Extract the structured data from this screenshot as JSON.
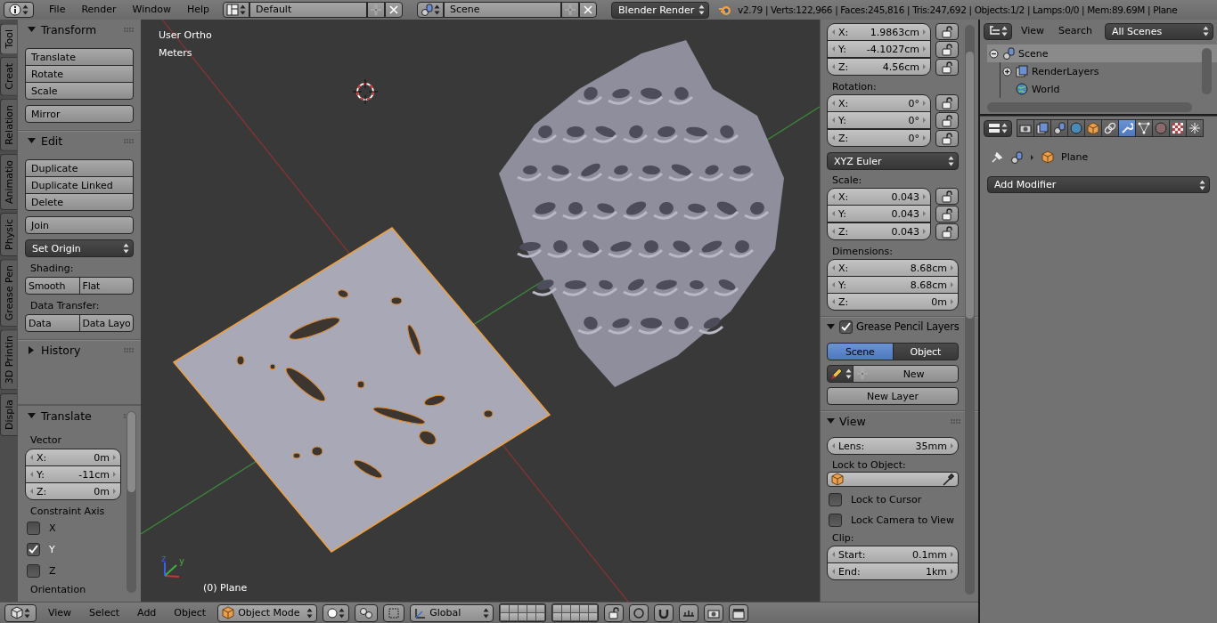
{
  "topbar": {
    "menus": [
      "File",
      "Render",
      "Window",
      "Help"
    ],
    "layout": "Default",
    "scene": "Scene",
    "engine": "Blender Render",
    "stats": "v2.79 | Verts:122,966 | Faces:245,816 | Tris:247,692 | Objects:1/2 | Lamps:0/0 | Mem:89.69M | Plane"
  },
  "tool_tabs": [
    {
      "label": "Tool",
      "selected": true
    },
    {
      "label": "Creat",
      "selected": false
    },
    {
      "label": "Relation",
      "selected": false
    },
    {
      "label": "Animatio",
      "selected": false
    },
    {
      "label": "Physic",
      "selected": false
    },
    {
      "label": "Grease Pen",
      "selected": false
    },
    {
      "label": "3D Printin",
      "selected": false
    },
    {
      "label": "Displa",
      "selected": false
    }
  ],
  "tool_shelf": {
    "panels": [
      {
        "title": "Transform",
        "expanded": true,
        "items": [
          {
            "kind": "button_column",
            "labels": [
              "Translate",
              "Rotate",
              "Scale"
            ]
          },
          {
            "kind": "button_column",
            "labels": [
              "Mirror"
            ]
          }
        ]
      },
      {
        "title": "Edit",
        "expanded": true,
        "items": [
          {
            "kind": "button_column",
            "labels": [
              "Duplicate",
              "Duplicate Linked",
              "Delete"
            ]
          },
          {
            "kind": "button_column",
            "labels": [
              "Join"
            ]
          },
          {
            "kind": "dropdown",
            "value": "Set Origin"
          },
          {
            "kind": "label",
            "text": "Shading:"
          },
          {
            "kind": "button_row",
            "labels": [
              "Smooth",
              "Flat"
            ]
          },
          {
            "kind": "label",
            "text": "Data Transfer:"
          },
          {
            "kind": "button_row",
            "labels": [
              "Data",
              "Data Layo"
            ]
          }
        ]
      },
      {
        "title": "History",
        "expanded": false
      }
    ]
  },
  "operator_panel": {
    "title": "Translate",
    "expanded": true,
    "items": [
      {
        "kind": "label",
        "text": "Vector"
      },
      {
        "kind": "vector",
        "fields": [
          {
            "label": "X:",
            "value": "0m"
          },
          {
            "label": "Y:",
            "value": "-11cm"
          },
          {
            "label": "Z:",
            "value": "0m"
          }
        ]
      },
      {
        "kind": "label",
        "text": "Constraint Axis"
      },
      {
        "kind": "checkbox",
        "label": "X",
        "checked": false
      },
      {
        "kind": "checkbox",
        "label": "Y",
        "checked": true
      },
      {
        "kind": "checkbox",
        "label": "Z",
        "checked": false
      },
      {
        "kind": "label",
        "text": "Orientation"
      }
    ]
  },
  "viewport": {
    "view_name": "User Ortho",
    "units": "Meters",
    "object_info": "(0) Plane",
    "axis_labels": [
      "z",
      "y"
    ]
  },
  "n_panel": {
    "items": [
      {
        "kind": "vector",
        "fields": [
          {
            "label": "X:",
            "value": "1.9863cm",
            "locked": false
          },
          {
            "label": "Y:",
            "value": "-4.1027cm",
            "locked": false
          },
          {
            "label": "Z:",
            "value": "4.56cm",
            "locked": false
          }
        ]
      },
      {
        "kind": "label",
        "text": "Rotation:"
      },
      {
        "kind": "vector",
        "fields": [
          {
            "label": "X:",
            "value": "0°",
            "locked": false
          },
          {
            "label": "Y:",
            "value": "0°",
            "locked": false
          },
          {
            "label": "Z:",
            "value": "0°",
            "locked": false
          }
        ]
      },
      {
        "kind": "dropdown",
        "value": "XYZ Euler"
      },
      {
        "kind": "label",
        "text": "Scale:"
      },
      {
        "kind": "vector",
        "fields": [
          {
            "label": "X:",
            "value": "0.043",
            "locked": false
          },
          {
            "label": "Y:",
            "value": "0.043",
            "locked": false
          },
          {
            "label": "Z:",
            "value": "0.043",
            "locked": false
          }
        ]
      },
      {
        "kind": "label",
        "text": "Dimensions:"
      },
      {
        "kind": "vector",
        "fields": [
          {
            "label": "X:",
            "value": "8.68cm"
          },
          {
            "label": "Y:",
            "value": "8.68cm"
          },
          {
            "label": "Z:",
            "value": "0m"
          }
        ]
      }
    ],
    "panels": [
      {
        "title": "Grease Pencil Layers",
        "expanded": true,
        "enabled": true,
        "items": [
          {
            "kind": "toggle_row",
            "options": [
              {
                "label": "Scene",
                "selected": true
              },
              {
                "label": "Object",
                "selected": false
              }
            ]
          },
          {
            "kind": "new_row",
            "label": "New"
          },
          {
            "kind": "wide_button",
            "label": "New Layer"
          }
        ]
      },
      {
        "title": "View",
        "expanded": true,
        "items": [
          {
            "kind": "vector",
            "fields": [
              {
                "label": "Lens:",
                "value": "35mm"
              }
            ]
          },
          {
            "kind": "label",
            "text": "Lock to Object:"
          },
          {
            "kind": "object_field"
          },
          {
            "kind": "checkbox",
            "label": "Lock to Cursor",
            "checked": false
          },
          {
            "kind": "checkbox",
            "label": "Lock Camera to View",
            "checked": false
          },
          {
            "kind": "label",
            "text": "Clip:"
          },
          {
            "kind": "vector",
            "fields": [
              {
                "label": "Start:",
                "value": "0.1mm"
              },
              {
                "label": "End:",
                "value": "1km"
              }
            ]
          }
        ]
      }
    ]
  },
  "header_3d": {
    "menus": [
      "View",
      "Select",
      "Add",
      "Object"
    ],
    "mode": "Object Mode",
    "orientation": "Global"
  },
  "outliner": {
    "menus": [
      "View",
      "Search"
    ],
    "filter": "All Scenes",
    "tree": [
      {
        "label": "Scene",
        "selected": true,
        "expanded": true,
        "children": [
          {
            "label": "RenderLayers",
            "selected": false,
            "expanded": false
          },
          {
            "label": "World",
            "selected": false
          }
        ]
      }
    ]
  },
  "properties": {
    "tabs": [
      {
        "selected": false
      },
      {
        "selected": false
      },
      {
        "selected": false
      },
      {
        "selected": false
      },
      {
        "selected": false
      },
      {
        "selected": false
      },
      {
        "selected": true
      },
      {
        "selected": false
      },
      {
        "selected": false
      },
      {
        "selected": false
      },
      {
        "selected": false
      }
    ],
    "breadcrumb": "Plane",
    "add_modifier": "Add Modifier"
  }
}
